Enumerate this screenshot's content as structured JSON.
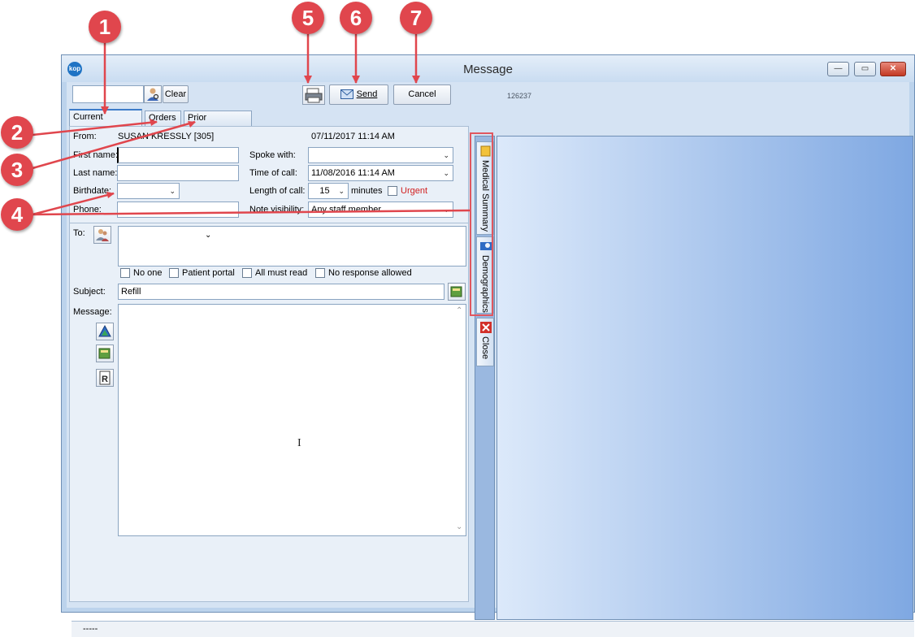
{
  "window": {
    "title": "Message",
    "app_icon": "kop",
    "controls": {
      "minimize": "—",
      "maximize": "▭",
      "close": "✕"
    }
  },
  "toolbar": {
    "clear_label": "Clear",
    "send_label": "Send",
    "cancel_label": "Cancel",
    "record_id": "126237"
  },
  "tabs": [
    {
      "label": "Current Message",
      "active": true
    },
    {
      "label": "Orders",
      "active": false
    },
    {
      "label": "Prior Messages",
      "active": false
    }
  ],
  "form": {
    "from_label": "From:",
    "from_value": "SUSAN KRESSLY [305]",
    "from_date": "07/11/2017 11:14 AM",
    "first_name_label": "First name:",
    "first_name_value": "",
    "last_name_label": "Last name:",
    "last_name_value": "",
    "birthdate_label": "Birthdate:",
    "birthdate_value": "",
    "phone_label": "Phone:",
    "phone_value": "",
    "spoke_with_label": "Spoke with:",
    "spoke_with_value": "",
    "time_of_call_label": "Time of call:",
    "time_of_call_value": "11/08/2016 11:14 AM",
    "length_label": "Length of call:",
    "length_value": "15",
    "minutes_label": "minutes",
    "urgent_label": "Urgent",
    "visibility_label": "Note visibility:",
    "visibility_value": "Any staff member",
    "to_label": "To:",
    "checkboxes": [
      "No one",
      "Patient portal",
      "All must read",
      "No response allowed"
    ],
    "subject_label": "Subject:",
    "subject_value": "Refill",
    "message_label": "Message:",
    "message_value": ""
  },
  "side_tabs": {
    "medical_summary": "Medical Summary",
    "demographics": "Demographics",
    "close": "Close"
  },
  "status": {
    "text": "-----"
  },
  "callouts": [
    "1",
    "2",
    "3",
    "4",
    "5",
    "6",
    "7"
  ],
  "colors": {
    "callout": "#e0464d",
    "urgent": "#d22020",
    "accent": "#3d7cc9"
  }
}
